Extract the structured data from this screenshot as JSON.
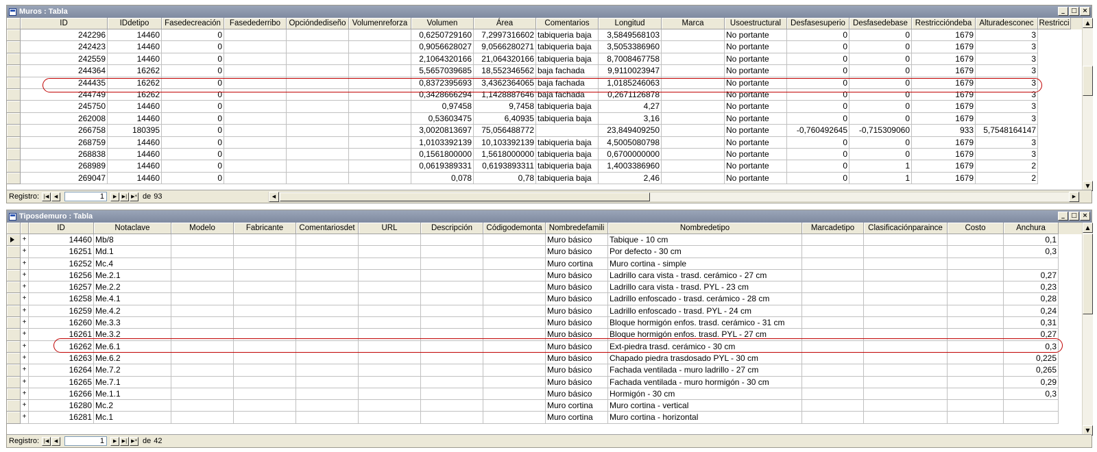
{
  "muros": {
    "title": "Muros : Tabla",
    "columns": [
      "ID",
      "IDdetipo",
      "Fasedecreación",
      "Fasedederribo",
      "Opcióndediseño",
      "Volumenreforza",
      "Volumen",
      "Área",
      "Comentarios",
      "Longitud",
      "Marca",
      "Usoestructural",
      "Desfasesuperio",
      "Desfasedebase",
      "Restriccióndeba",
      "Alturadesconec",
      "Restricci"
    ],
    "rows": [
      [
        "242296",
        "14460",
        "0",
        "",
        "",
        "",
        "0,6250729160",
        "7,2997316602",
        "tabiqueria baja",
        "3,5849568103",
        "",
        "No portante",
        "0",
        "0",
        "1679",
        "3"
      ],
      [
        "242423",
        "14460",
        "0",
        "",
        "",
        "",
        "0,9056628027",
        "9,0566280271",
        "tabiqueria baja",
        "3,5053386960",
        "",
        "No portante",
        "0",
        "0",
        "1679",
        "3"
      ],
      [
        "242559",
        "14460",
        "0",
        "",
        "",
        "",
        "2,1064320166",
        "21,064320166",
        "tabiqueria baja",
        "8,7008467758",
        "",
        "No portante",
        "0",
        "0",
        "1679",
        "3"
      ],
      [
        "244364",
        "16262",
        "0",
        "",
        "",
        "",
        "5,5657039685",
        "18,552346562",
        "baja fachada",
        "9,9110023947",
        "",
        "No portante",
        "0",
        "0",
        "1679",
        "3"
      ],
      [
        "244435",
        "16262",
        "0",
        "",
        "",
        "",
        "0,8372395693",
        "3,4362364065",
        "baja fachada",
        "1,0185246063",
        "",
        "No portante",
        "0",
        "0",
        "1679",
        "3"
      ],
      [
        "244749",
        "16262",
        "0",
        "",
        "",
        "",
        "0,3428666294",
        "1,1428887646",
        "baja fachada",
        "0,2671126878",
        "",
        "No portante",
        "0",
        "0",
        "1679",
        "3"
      ],
      [
        "245750",
        "14460",
        "0",
        "",
        "",
        "",
        "0,97458",
        "9,7458",
        "tabiqueria baja",
        "4,27",
        "",
        "No portante",
        "0",
        "0",
        "1679",
        "3"
      ],
      [
        "262008",
        "14460",
        "0",
        "",
        "",
        "",
        "0,53603475",
        "6,40935",
        "tabiqueria baja",
        "3,16",
        "",
        "No portante",
        "0",
        "0",
        "1679",
        "3"
      ],
      [
        "266758",
        "180395",
        "0",
        "",
        "",
        "",
        "3,0020813697",
        "75,056488772",
        "",
        "23,849409250",
        "",
        "No portante",
        "-0,760492645",
        "-0,715309060",
        "933",
        "5,7548164147"
      ],
      [
        "268759",
        "14460",
        "0",
        "",
        "",
        "",
        "1,0103392139",
        "10,103392139",
        "tabiqueria baja",
        "4,5005080798",
        "",
        "No portante",
        "0",
        "0",
        "1679",
        "3"
      ],
      [
        "268838",
        "14460",
        "0",
        "",
        "",
        "",
        "0,1561800000",
        "1,5618000000",
        "tabiqueria baja",
        "0,6700000000",
        "",
        "No portante",
        "0",
        "0",
        "1679",
        "3"
      ],
      [
        "268989",
        "14460",
        "0",
        "",
        "",
        "",
        "0,0619389331",
        "0,6193893311",
        "tabiqueria baja",
        "1,4003386960",
        "",
        "No portante",
        "0",
        "1",
        "1679",
        "2"
      ],
      [
        "269047",
        "14460",
        "0",
        "",
        "",
        "",
        "0,078",
        "0,78",
        "tabiqueria baja",
        "2,46",
        "",
        "No portante",
        "0",
        "1",
        "1679",
        "2"
      ]
    ],
    "status": {
      "label": "Registro:",
      "current": "1",
      "of_label": "de",
      "total": "93"
    }
  },
  "tipos": {
    "title": "Tiposdemuro : Tabla",
    "columns": [
      "ID",
      "Notaclave",
      "Modelo",
      "Fabricante",
      "Comentariosdet",
      "URL",
      "Descripción",
      "Códigodemonta",
      "Nombredefamili",
      "Nombredetipo",
      "Marcadetipo",
      "Clasificaciónparaince",
      "Costo",
      "Anchura"
    ],
    "rows": [
      [
        "14460",
        "Mb/8",
        "",
        "",
        "",
        "",
        "",
        "",
        "Muro básico",
        "Tabique - 10 cm",
        "",
        "",
        "",
        "0,1"
      ],
      [
        "16251",
        "Md.1",
        "",
        "",
        "",
        "",
        "",
        "",
        "Muro básico",
        "Por defecto - 30 cm",
        "",
        "",
        "",
        "0,3"
      ],
      [
        "16252",
        "Mc.4",
        "",
        "",
        "",
        "",
        "",
        "",
        "Muro cortina",
        "Muro cortina - simple",
        "",
        "",
        "",
        ""
      ],
      [
        "16256",
        "Me.2.1",
        "",
        "",
        "",
        "",
        "",
        "",
        "Muro básico",
        "Ladrillo cara vista - trasd. cerámico - 27 cm",
        "",
        "",
        "",
        "0,27"
      ],
      [
        "16257",
        "Me.2.2",
        "",
        "",
        "",
        "",
        "",
        "",
        "Muro básico",
        "Ladrillo cara vista - trasd. PYL - 23 cm",
        "",
        "",
        "",
        "0,23"
      ],
      [
        "16258",
        "Me.4.1",
        "",
        "",
        "",
        "",
        "",
        "",
        "Muro básico",
        "Ladrillo enfoscado - trasd. cerámico - 28 cm",
        "",
        "",
        "",
        "0,28"
      ],
      [
        "16259",
        "Me.4.2",
        "",
        "",
        "",
        "",
        "",
        "",
        "Muro básico",
        "Ladrillo enfoscado - trasd. PYL - 24 cm",
        "",
        "",
        "",
        "0,24"
      ],
      [
        "16260",
        "Me.3.3",
        "",
        "",
        "",
        "",
        "",
        "",
        "Muro básico",
        "Bloque hormigón enfos. trasd. cerámico - 31 cm",
        "",
        "",
        "",
        "0,31"
      ],
      [
        "16261",
        "Me.3.2",
        "",
        "",
        "",
        "",
        "",
        "",
        "Muro básico",
        "Bloque hormigón enfos. trasd. PYL - 27 cm",
        "",
        "",
        "",
        "0,27"
      ],
      [
        "16262",
        "Me.6.1",
        "",
        "",
        "",
        "",
        "",
        "",
        "Muro básico",
        "Ext-piedra trasd. cerámico - 30 cm",
        "",
        "",
        "",
        "0,3"
      ],
      [
        "16263",
        "Me.6.2",
        "",
        "",
        "",
        "",
        "",
        "",
        "Muro básico",
        "Chapado piedra trasdosado PYL - 30 cm",
        "",
        "",
        "",
        "0,225"
      ],
      [
        "16264",
        "Me.7.2",
        "",
        "",
        "",
        "",
        "",
        "",
        "Muro básico",
        "Fachada ventilada - muro ladrillo - 27 cm",
        "",
        "",
        "",
        "0,265"
      ],
      [
        "16265",
        "Me.7.1",
        "",
        "",
        "",
        "",
        "",
        "",
        "Muro básico",
        "Fachada ventilada - muro hormigón - 30 cm",
        "",
        "",
        "",
        "0,29"
      ],
      [
        "16266",
        "Me.1.1",
        "",
        "",
        "",
        "",
        "",
        "",
        "Muro básico",
        "Hormigón - 30 cm",
        "",
        "",
        "",
        "0,3"
      ],
      [
        "16280",
        "Mc.2",
        "",
        "",
        "",
        "",
        "",
        "",
        "Muro cortina",
        "Muro cortina - vertical",
        "",
        "",
        "",
        ""
      ],
      [
        "16281",
        "Mc.1",
        "",
        "",
        "",
        "",
        "",
        "",
        "Muro cortina",
        "Muro cortina - horizontal",
        "",
        "",
        "",
        ""
      ]
    ],
    "expand_glyph": "+",
    "status": {
      "label": "Registro:",
      "current": "1",
      "of_label": "de",
      "total": "42"
    }
  },
  "highlight_color": "#c00000"
}
